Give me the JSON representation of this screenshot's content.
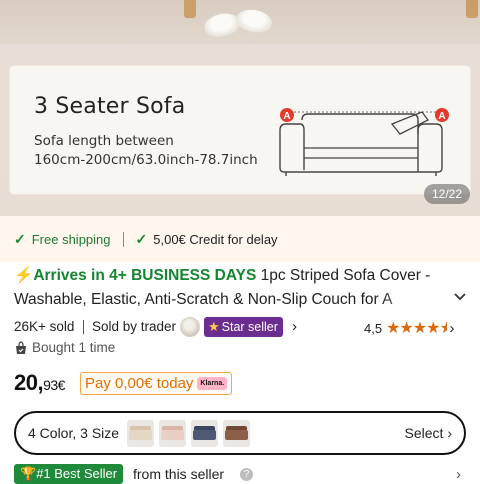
{
  "gallery": {
    "card_title": "3 Seater Sofa",
    "card_desc_line1": "Sofa length between",
    "card_desc_line2": "160cm-200cm/63.0inch-78.7inch",
    "marker_label": "A",
    "counter": "12/22"
  },
  "shipping": {
    "free_shipping": "Free shipping",
    "credit": "5,00€ Credit for delay"
  },
  "product": {
    "arrives": "Arrives in 4+ BUSINESS DAYS",
    "title": "1pc Striped Sofa Cover - Washable, Elastic, Anti-Scratch & Non-Slip Couch for A",
    "sold": "26K+ sold",
    "sold_by": "Sold by trader",
    "star_seller": "Star seller",
    "rating": "4,5",
    "rating_value": 4.5,
    "rating_max": 5,
    "bought": "Bought 1 time",
    "price_main": "20,",
    "price_cents": "93€",
    "pay_today": "Pay 0,00€ today",
    "klarna": "Klarna."
  },
  "variant": {
    "label": "4 Color, 3 Size",
    "select": "Select",
    "swatches": [
      {
        "name": "beige",
        "color": "#e4d7c6",
        "back": "#d6c4ac"
      },
      {
        "name": "pink",
        "color": "#e9cfc6",
        "back": "#d9b4a8"
      },
      {
        "name": "navy",
        "color": "#4e5a74",
        "back": "#3c465e"
      },
      {
        "name": "brown",
        "color": "#8c6048",
        "back": "#704a36"
      }
    ]
  },
  "best_seller": {
    "badge": "#1 Best Seller",
    "from": "from this seller"
  },
  "colors": {
    "green": "#1c7a34",
    "orange": "#e56f00",
    "purple": "#6b2d8f",
    "star": "#de6a10"
  }
}
